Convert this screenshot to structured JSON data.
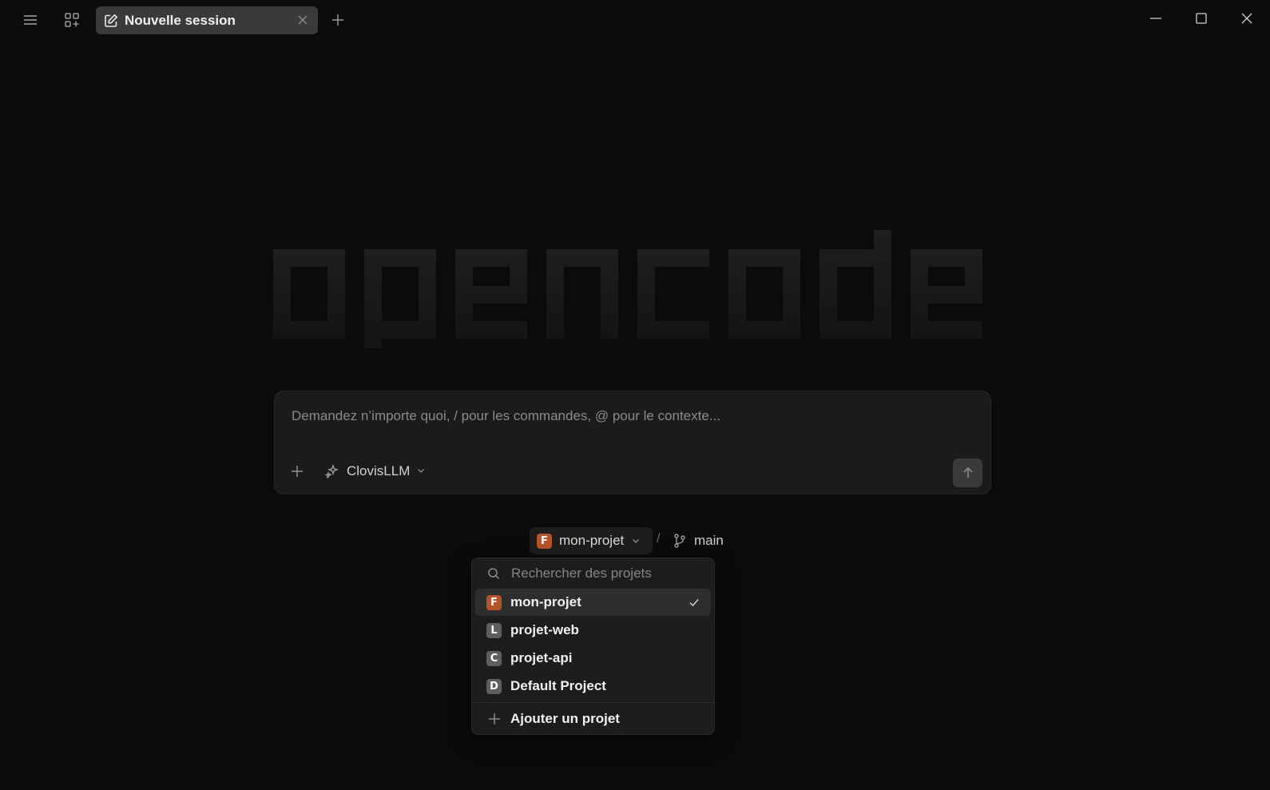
{
  "tab": {
    "title": "Nouvelle session"
  },
  "logo": {
    "text": "opencode"
  },
  "prompt": {
    "placeholder": "Demandez n’importe quoi, / pour les commandes, @ pour le contexte...",
    "model": "ClovisLLM"
  },
  "project": {
    "badge": "F",
    "name": "mon-projet",
    "badge_color": "#b5532a",
    "separator": "/",
    "branch": "main"
  },
  "dropdown": {
    "search_placeholder": "Rechercher des projets",
    "items": [
      {
        "badge": "F",
        "label": "mon-projet",
        "badge_color": "#b5532a",
        "selected": true
      },
      {
        "badge": "L",
        "label": "projet-web",
        "badge_color": "#5e5e5e",
        "selected": false
      },
      {
        "badge": "C",
        "label": "projet-api",
        "badge_color": "#5e5e5e",
        "selected": false
      },
      {
        "badge": "D",
        "label": "Default Project",
        "badge_color": "#5e5e5e",
        "selected": false
      }
    ],
    "add_label": "Ajouter un projet"
  },
  "icons": {
    "menu": "hamburger-icon",
    "layout": "grid-plus-icon",
    "tab_edit": "edit-square-icon",
    "tab_close": "close-icon",
    "new_tab": "plus-icon",
    "minimize": "minimize-icon",
    "maximize": "maximize-icon",
    "close": "window-close-icon",
    "attach": "plus-icon",
    "model": "sparkle-icon",
    "send": "arrow-up-icon",
    "branch": "git-branch-icon",
    "search": "search-icon",
    "check": "check-icon"
  }
}
